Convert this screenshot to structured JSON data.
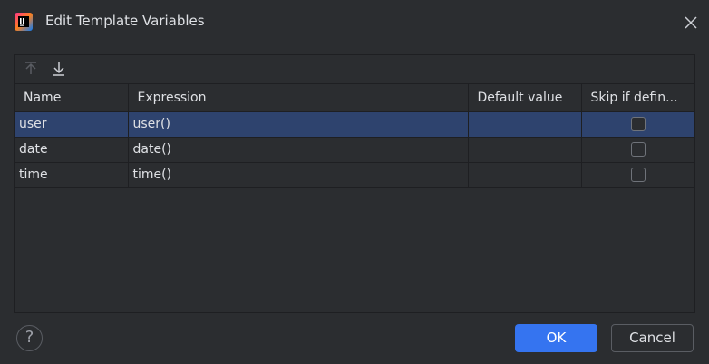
{
  "window": {
    "title": "Edit Template Variables",
    "icon": "intellij-idea-icon"
  },
  "toolbar": {
    "move_up_icon": "arrow-up-icon",
    "move_down_icon": "arrow-down-icon"
  },
  "table": {
    "headers": [
      "Name",
      "Expression",
      "Default value",
      "Skip if defin..."
    ],
    "rows": [
      {
        "name": "user",
        "expression": "user()",
        "default": "",
        "skip": false
      },
      {
        "name": "date",
        "expression": "date()",
        "default": "",
        "skip": false
      },
      {
        "name": "time",
        "expression": "time()",
        "default": "",
        "skip": false
      }
    ],
    "selected_row": 0
  },
  "footer": {
    "help_label": "?",
    "ok_label": "OK",
    "cancel_label": "Cancel"
  },
  "colors": {
    "accent": "#3574f0",
    "selection": "#2e436e",
    "background": "#2b2d30"
  }
}
